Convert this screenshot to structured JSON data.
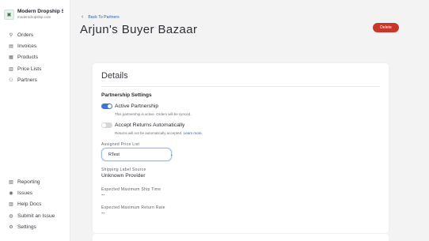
{
  "org": {
    "name": "Modern Dropship Sel...",
    "domain": "moderndropship.com",
    "logo_glyph": "▣"
  },
  "nav_top": [
    {
      "label": "Orders",
      "icon": "user-icon",
      "glyph": "⚲"
    },
    {
      "label": "Invoices",
      "icon": "document-icon",
      "glyph": "▤"
    },
    {
      "label": "Products",
      "icon": "box-icon",
      "glyph": "▦"
    },
    {
      "label": "Price Lists",
      "icon": "list-icon",
      "glyph": "▥"
    },
    {
      "label": "Partners",
      "icon": "partners-icon",
      "glyph": "⚇"
    }
  ],
  "nav_bottom": [
    {
      "label": "Reporting",
      "icon": "chart-icon",
      "glyph": "▧"
    },
    {
      "label": "Issues",
      "icon": "alert-icon",
      "glyph": "◉"
    },
    {
      "label": "Help Docs",
      "icon": "help-icon",
      "glyph": "▨"
    },
    {
      "label": "Submit an Issue",
      "icon": "flag-icon",
      "glyph": "◍"
    },
    {
      "label": "Settings",
      "icon": "gear-icon",
      "glyph": "⚙"
    }
  ],
  "header": {
    "back_label": "Back To Partners",
    "back_glyph": "‹",
    "title": "Arjun's Buyer Bazaar",
    "delete_label": "Delete"
  },
  "details": {
    "title": "Details",
    "section_title": "Partnership Settings",
    "active_partnership": {
      "label": "Active Partnership",
      "help": "This partnership is active. Orders will be synced.",
      "enabled": true
    },
    "accept_returns": {
      "label": "Accept Returns Automatically",
      "help": "Returns will not be automatically accepted.",
      "learn_more": "Learn more.",
      "enabled": false
    },
    "price_list": {
      "label": "Assigned Price List",
      "value": "RTest",
      "caret": "⌄"
    },
    "shipping_label": {
      "label": "Shipping Label Source",
      "value": "Unknown Provider"
    },
    "ship_time": {
      "label": "Expected Maximum Ship Time",
      "value": "--"
    },
    "return_rate": {
      "label": "Expected Maximum Return Rate",
      "value": "--"
    }
  },
  "colors": {
    "accent": "#3b77d6",
    "danger": "#c8382a",
    "link": "#2f5da8"
  }
}
